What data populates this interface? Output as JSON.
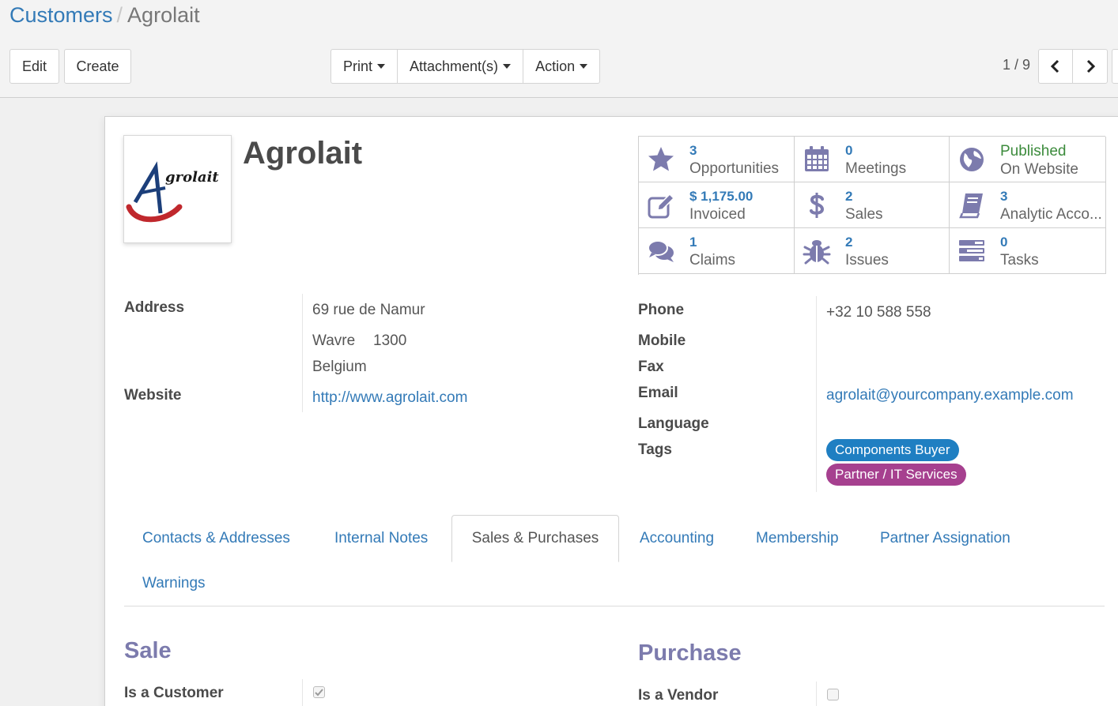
{
  "breadcrumb": {
    "parent": "Customers",
    "separator": "/",
    "current": "Agrolait"
  },
  "toolbar": {
    "edit_label": "Edit",
    "create_label": "Create",
    "print_label": "Print",
    "attachments_label": "Attachment(s)",
    "action_label": "Action"
  },
  "pager": {
    "value": "1 / 9"
  },
  "partner": {
    "name": "Agrolait",
    "logo_text": "grolait"
  },
  "smart_buttons": {
    "opportunities": {
      "value": "3",
      "label": "Opportunities",
      "icon": "star-icon"
    },
    "meetings": {
      "value": "0",
      "label": "Meetings",
      "icon": "calendar-icon"
    },
    "website": {
      "line1": "Published",
      "line2": "On Website",
      "icon": "globe-icon"
    },
    "invoiced": {
      "value": "$ 1,175.00",
      "label": "Invoiced",
      "icon": "edit-icon"
    },
    "sales": {
      "value": "2",
      "label": "Sales",
      "icon": "dollar-icon"
    },
    "analytic": {
      "value": "3",
      "label": "Analytic Acco...",
      "icon": "book-icon"
    },
    "claims": {
      "value": "1",
      "label": "Claims",
      "icon": "comments-icon"
    },
    "issues": {
      "value": "2",
      "label": "Issues",
      "icon": "bug-icon"
    },
    "tasks": {
      "value": "0",
      "label": "Tasks",
      "icon": "tasks-icon"
    }
  },
  "fields": {
    "address_label": "Address",
    "street": "69 rue de Namur",
    "city": "Wavre",
    "zip": "1300",
    "country": "Belgium",
    "website_label": "Website",
    "website": "http://www.agrolait.com",
    "phone_label": "Phone",
    "phone": "+32 10 588 558",
    "mobile_label": "Mobile",
    "fax_label": "Fax",
    "email_label": "Email",
    "email": "agrolait@yourcompany.example.com",
    "language_label": "Language",
    "tags_label": "Tags"
  },
  "tags": [
    {
      "label": "Components Buyer",
      "color": "#1f7fc2"
    },
    {
      "label": "Partner / IT Services",
      "color": "#a6408f"
    }
  ],
  "tabs": [
    "Contacts & Addresses",
    "Internal Notes",
    "Sales & Purchases",
    "Accounting",
    "Membership",
    "Partner Assignation",
    "Warnings"
  ],
  "sale": {
    "title": "Sale",
    "is_customer_label": "Is a Customer",
    "is_customer": true
  },
  "purchase": {
    "title": "Purchase",
    "is_vendor_label": "Is a Vendor",
    "is_vendor": false
  },
  "colors": {
    "link": "#337ab7",
    "icon": "#7c7bad",
    "published": "#3c8b3c"
  }
}
